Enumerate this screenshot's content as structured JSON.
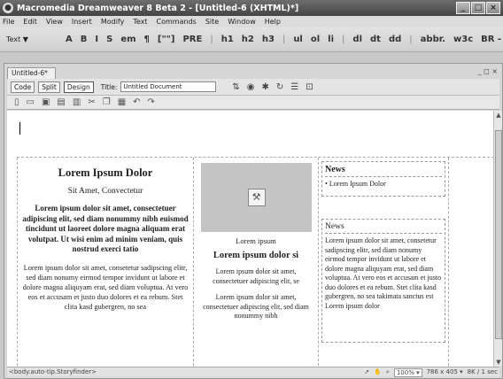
{
  "window": {
    "title": "Macromedia Dreamweaver 8 Beta 2 - [Untitled-6 (XHTML)*]",
    "icon": "dw-logo-icon",
    "controls": [
      "_",
      "□",
      "×"
    ]
  },
  "menu": [
    "File",
    "Edit",
    "View",
    "Insert",
    "Modify",
    "Text",
    "Commands",
    "Site",
    "Window",
    "Help"
  ],
  "insert_toolbar": {
    "category": "Text ▼",
    "tools": [
      "A",
      "B",
      "I",
      "S",
      "em",
      "¶",
      "[\"\"]",
      "PRE",
      "h1",
      "h2",
      "h3",
      "ul",
      "ol",
      "li",
      "dl",
      "dt",
      "dd",
      "abbr.",
      "w3c",
      "BR -"
    ]
  },
  "document": {
    "tab": "Untitled-6*",
    "views": [
      "Code",
      "Split",
      "Design"
    ],
    "title_label": "Title:",
    "title_value": "Untitled Document"
  },
  "content": {
    "col1": {
      "heading": "Lorem Ipsum Dolor",
      "subheading": "Sit Amet, Convectetur",
      "lead": "Lorem ipsum dolor sit amet, consectetuer adipiscing elit, sed diam nonummy nibh euismod tincidunt ut laoreet dolore magna aliquam erat volutpat. Ut wisi enim ad minim veniam, quis nostrud exerci tatio",
      "body": "Lorem ipsum dolor sit amet, consetetur sadipscing elitr, sed diam nonumy eirmod tempor invidunt ut labore et dolore magna aliquyam erat, sed diam voluptua. At vero eos et accusam et justo duo dolores et ea rebum. Stet clita kasd gubergren, no sea"
    },
    "col2": {
      "caption": "Lorem ipsum",
      "heading": "Lorem ipsum dolor si",
      "p1": "Lorem ipsum dolor sit amet, consectetuer adipiscing elit, se",
      "p2": "Lorem ipsum dolor sit amet, consectetuer adipiscing elit, sed diam nonummy nibh"
    },
    "col3": {
      "news1_heading": "News",
      "news1_item": "Lorem Ipsum Dolor",
      "news2_heading": "News",
      "news2_body": "Lorem ipsum dolor sit amet, consetetur sadipscing elitr, sed diam nonumy eirmod tempor invidunt ut labore et dolore magna aliquyam erat, sed diam voluptua. At vero eos et accusam et justo duo dolores et ea rebum. Stet clita kasd gubergren, no sea takimata sanctus est Lorem ipsum dolor"
    }
  },
  "status": {
    "tags": "<body.auto-tip.Storyfinder>",
    "zoom": "100% ▾",
    "dimensions": "786 x 405 ▾",
    "size_time": "8K / 1 sec"
  }
}
